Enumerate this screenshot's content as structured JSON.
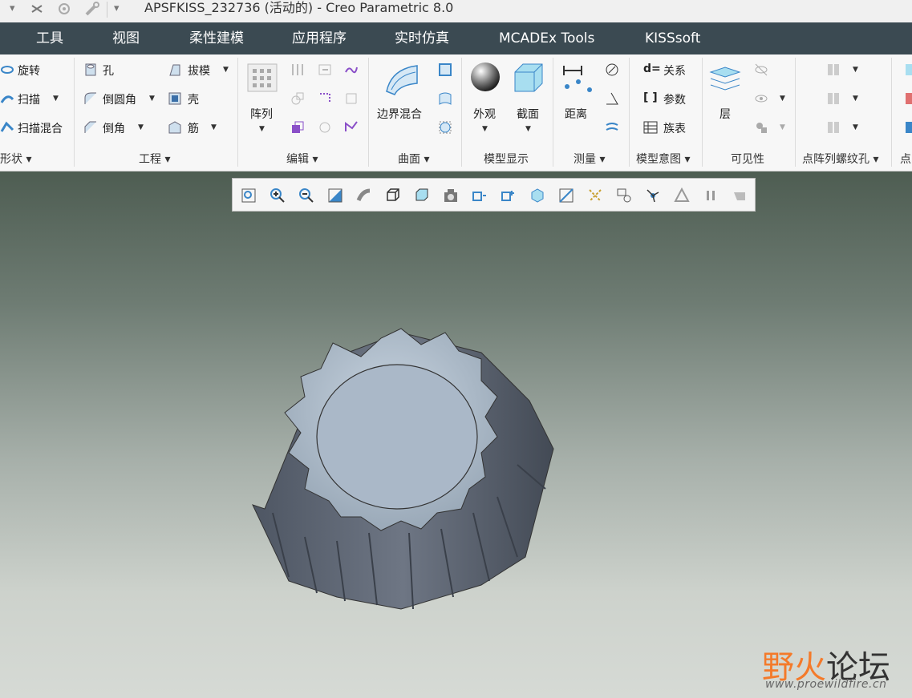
{
  "window": {
    "title": "APSFKISS_232736 (活动的) - Creo Parametric 8.0"
  },
  "quick_access": {
    "icons": [
      "dropdown-arrow-icon",
      "close-window-icon",
      "regenerate-gear-icon",
      "tools-wrench-icon",
      "customize-arrow-icon"
    ]
  },
  "menu": {
    "tabs": [
      "工具",
      "视图",
      "柔性建模",
      "应用程序",
      "实时仿真",
      "MCADEx Tools",
      "KISSsoft"
    ]
  },
  "ribbon": {
    "shape": {
      "items": [
        "旋转",
        "扫描",
        "扫描混合"
      ],
      "label": "形状"
    },
    "engineering": {
      "items": [
        "孔",
        "倒圆角",
        "倒角",
        "拔模",
        "壳",
        "筋"
      ],
      "label": "工程"
    },
    "edit": {
      "pattern": "阵列",
      "label": "编辑"
    },
    "surface": {
      "boundary_blend": "边界混合",
      "label": "曲面"
    },
    "model_display": {
      "appearance": "外观",
      "section": "截面",
      "label": "模型显示"
    },
    "measure": {
      "distance": "距离",
      "label": "测量"
    },
    "model_intent": {
      "items": [
        "关系",
        "参数",
        "族表"
      ],
      "label": "模型意图"
    },
    "visibility": {
      "layers": "层",
      "label": "可见性"
    },
    "pattern_hole": {
      "label": "点阵列螺纹孔"
    },
    "last": {
      "label": "点"
    }
  },
  "view_toolbar": {
    "icons": [
      "refit-icon",
      "zoom-in-icon",
      "zoom-out-icon",
      "repaint-icon",
      "display-style-icon",
      "saved-orientations-icon",
      "view-manager-icon",
      "perspective-camera-icon",
      "datum-display-icon",
      "spin-center-icon",
      "annotation-display-icon",
      "section-display-icon",
      "point-display-icon",
      "appearance-icon",
      "csys-icon",
      "simulation-icon",
      "pause-icon",
      "play-icon"
    ]
  },
  "watermark": {
    "text_a": "野火",
    "text_b": "论坛",
    "url": "www.proewildfire.cn"
  }
}
